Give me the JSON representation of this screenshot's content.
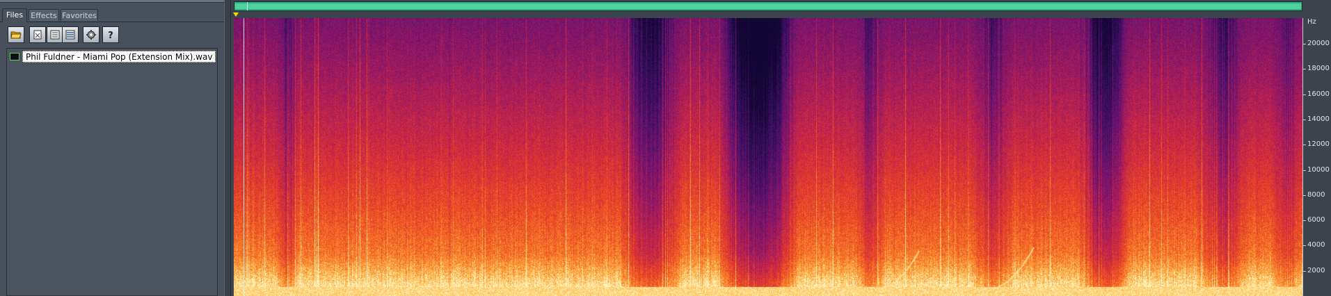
{
  "tabs": [
    {
      "label": "Files",
      "active": true
    },
    {
      "label": "Effects",
      "active": false
    },
    {
      "label": "Favorites",
      "active": false
    }
  ],
  "toolbar": {
    "buttons": [
      {
        "icon": "folder-open-icon"
      },
      {
        "icon": "close-file-icon"
      },
      {
        "icon": "close-all-icon"
      },
      {
        "icon": "multitrack-icon"
      },
      {
        "icon": "properties-icon"
      },
      {
        "icon": "help-icon"
      }
    ]
  },
  "files": [
    {
      "name": "Phil Fuldner - Miami Pop (Extension Mix).wav",
      "selected": true
    }
  ],
  "frequency_axis": {
    "unit": "Hz",
    "labels": [
      "20000",
      "18000",
      "16000",
      "14000",
      "12000",
      "10000",
      "8000",
      "6000",
      "4000",
      "2000"
    ],
    "max_hz": 22050
  },
  "colors": {
    "overview": "#4ad39e",
    "playhead": "#ffd400",
    "panel_bg": "#47505b",
    "spectrum_low": "#1a0a3d",
    "spectrum_high": "#fff2b0"
  }
}
